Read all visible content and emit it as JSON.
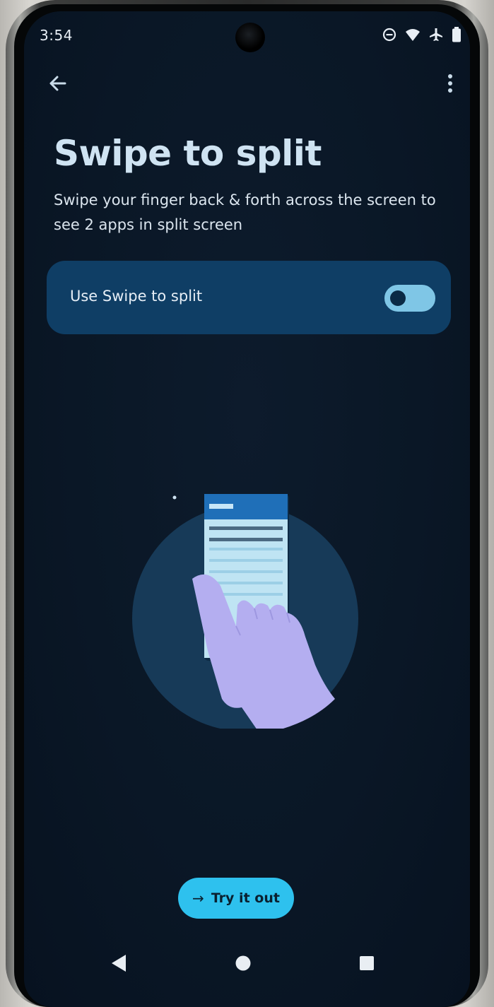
{
  "status_bar": {
    "time": "3:54",
    "icons": [
      "do-not-disturb-icon",
      "wifi-icon",
      "airplane-mode-icon",
      "battery-icon"
    ]
  },
  "top_nav": {
    "back_icon": "arrow-back-icon",
    "more_icon": "more-vert-icon"
  },
  "page": {
    "title": "Swipe to split",
    "description": "Swipe your finger back & forth across the screen to see 2 apps in split screen"
  },
  "setting": {
    "label": "Use Swipe to split",
    "toggle_on": false
  },
  "illustration": {
    "icon": "swipe-to-split-illustration"
  },
  "cta": {
    "label": "Try it out",
    "icon": "arrow-forward-icon"
  },
  "system_nav": {
    "back": "nav-back-icon",
    "home": "nav-home-icon",
    "recents": "nav-recents-icon"
  },
  "colors": {
    "background": "#0a1726",
    "card": "#0f3e65",
    "accent": "#2ec1ee",
    "toggle_track": "#7fc6e6",
    "title": "#cfe3f2"
  }
}
